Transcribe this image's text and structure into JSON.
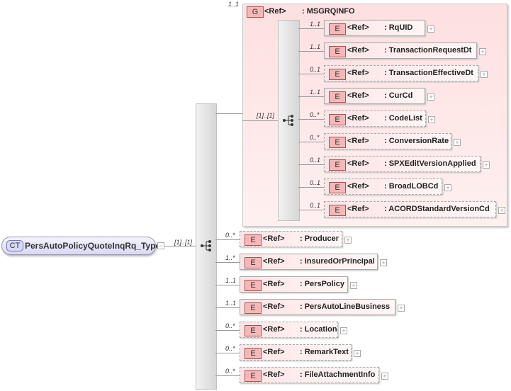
{
  "root": {
    "badge": "CT",
    "name": "PersAutoPolicyQuoteInqRq_Type",
    "card": "[1]..[1]"
  },
  "group": {
    "badge": "G",
    "ref": "<Ref>",
    "name": ": MSGRQINFO",
    "card": "1..1",
    "seq_card": "[1]..[1]"
  },
  "inner": [
    {
      "card": "1..1",
      "badge": "E",
      "ref": "<Ref>",
      "name": ": RqUID",
      "optional": false
    },
    {
      "card": "1..1",
      "badge": "E",
      "ref": "<Ref>",
      "name": ": TransactionRequestDt",
      "optional": false
    },
    {
      "card": "0..1",
      "badge": "E",
      "ref": "<Ref>",
      "name": ": TransactionEffectiveDt",
      "optional": true
    },
    {
      "card": "1..1",
      "badge": "E",
      "ref": "<Ref>",
      "name": ": CurCd",
      "optional": false
    },
    {
      "card": "0..*",
      "badge": "E",
      "ref": "<Ref>",
      "name": ": CodeList",
      "optional": true
    },
    {
      "card": "0..*",
      "badge": "E",
      "ref": "<Ref>",
      "name": ": ConversionRate",
      "optional": true
    },
    {
      "card": "0..1",
      "badge": "E",
      "ref": "<Ref>",
      "name": ": SPXEditVersionApplied",
      "optional": true
    },
    {
      "card": "0..1",
      "badge": "E",
      "ref": "<Ref>",
      "name": ": BroadLOBCd",
      "optional": true
    },
    {
      "card": "0..1",
      "badge": "E",
      "ref": "<Ref>",
      "name": ": ACORDStandardVersionCd",
      "optional": true
    }
  ],
  "outer": [
    {
      "card": "0..*",
      "badge": "E",
      "ref": "<Ref>",
      "name": ": Producer",
      "optional": true
    },
    {
      "card": "1..*",
      "badge": "E",
      "ref": "<Ref>",
      "name": ": InsuredOrPrincipal",
      "optional": false
    },
    {
      "card": "1..1",
      "badge": "E",
      "ref": "<Ref>",
      "name": ": PersPolicy",
      "optional": false
    },
    {
      "card": "1..1",
      "badge": "E",
      "ref": "<Ref>",
      "name": ": PersAutoLineBusiness",
      "optional": false
    },
    {
      "card": "0..*",
      "badge": "E",
      "ref": "<Ref>",
      "name": ": Location",
      "optional": true
    },
    {
      "card": "0..*",
      "badge": "E",
      "ref": "<Ref>",
      "name": ": RemarkText",
      "optional": true
    },
    {
      "card": "0..*",
      "badge": "E",
      "ref": "<Ref>",
      "name": ": FileAttachmentInfo",
      "optional": true
    }
  ]
}
